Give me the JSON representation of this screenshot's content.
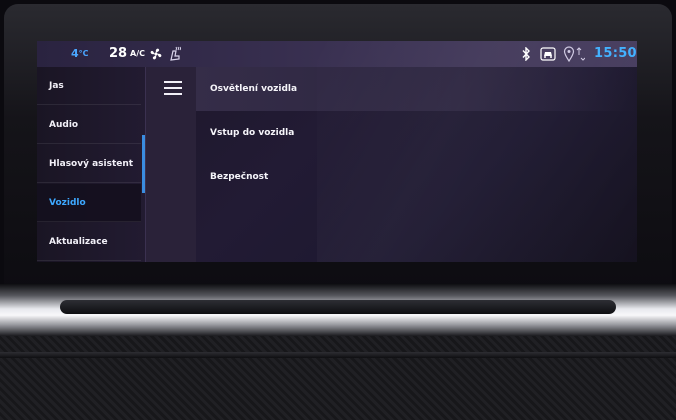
{
  "status_bar": {
    "temp_left": "4",
    "temp_left_unit": "°C",
    "temp_right": "28",
    "ac_label": "A/C",
    "time": "15:50",
    "icons": [
      "fan-icon",
      "seat-heat-icon",
      "bluetooth-icon",
      "car-connect-icon",
      "navigation-icon"
    ]
  },
  "sidebar": {
    "items": [
      {
        "label": "Jas"
      },
      {
        "label": "Audio"
      },
      {
        "label": "Hlasový asistent"
      },
      {
        "label": "Vozidlo",
        "active": true
      },
      {
        "label": "Aktualizace"
      }
    ]
  },
  "main": {
    "items": [
      {
        "label": "Osvětlení vozidla"
      },
      {
        "label": "Vstup do vozidla"
      },
      {
        "label": "Bezpečnost"
      }
    ]
  },
  "colors": {
    "accent": "#3da8ff",
    "screen_bg": "#221b34",
    "text": "#f2f0f8"
  }
}
